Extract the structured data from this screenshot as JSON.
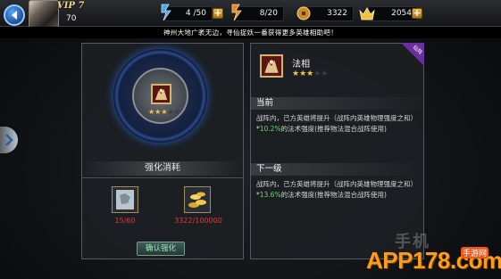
{
  "header": {
    "vip_label": "VIP 7",
    "level": "70",
    "resources": [
      {
        "icon": "stamina-icon",
        "value": "4 /50",
        "has_plus": true
      },
      {
        "icon": "flame-energy-icon",
        "value": "8/20",
        "has_plus": false
      },
      {
        "icon": "coin-icon",
        "value": "3322",
        "has_plus": false
      },
      {
        "icon": "crown-gold-icon",
        "value": "2054",
        "has_plus": true
      }
    ]
  },
  "notice": "神州大地广袤无边，寻仙捉妖一番获得更多英雄相助吧！",
  "left_panel": {
    "emblem_stars": 3,
    "title": "强化消耗",
    "materials": [
      {
        "icon": "scroll-material-icon",
        "count": "15/60"
      },
      {
        "icon": "gold-coins-material-icon",
        "count": "3322/100000"
      }
    ],
    "confirm_label": "确认强化"
  },
  "right_panel": {
    "badge": "仙阵",
    "skill_name": "法相",
    "stars_total": 5,
    "stars_filled": 3,
    "current": {
      "heading": "当前",
      "text_before": "战阵内，己方英雄将提升（战阵内英雄物理强度之和）*",
      "highlight": "10.2%",
      "text_after": "的法术强度(推荐物法混合战阵使用)"
    },
    "next": {
      "heading": "下一级",
      "text_before": "战阵内，己方英雄将提升（战阵内英雄物理强度之和）*",
      "highlight": "13.6%",
      "text_after": "的法术强度(推荐物法混合战阵使用)"
    }
  },
  "watermark": {
    "cn_text": "手机",
    "logo": "APP178.com",
    "tag": "手游网"
  },
  "colors": {
    "accent_gold": "#f5c542",
    "highlight_green": "#6fd46f",
    "cost_red": "#e03a3a",
    "watermark_orange": "#ff9c1a"
  }
}
